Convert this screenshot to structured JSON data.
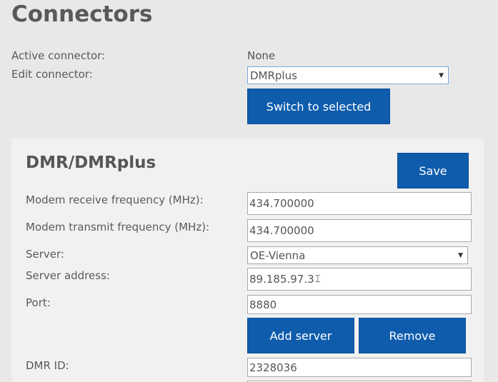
{
  "page": {
    "title": "Connectors"
  },
  "connectors": {
    "active_label": "Active connector:",
    "active_value": "None",
    "edit_label": "Edit connector:",
    "edit_selected": "DMRplus",
    "switch_button": "Switch to selected"
  },
  "panel": {
    "title": "DMR/DMRplus",
    "save_button": "Save",
    "rx_label": "Modem receive frequency (MHz):",
    "rx_value": "434.700000",
    "tx_label": "Modem transmit frequency (MHz):",
    "tx_value": "434.700000",
    "server_label": "Server:",
    "server_selected": "OE-Vienna",
    "address_label": "Server address:",
    "address_value": "89.185.97.3",
    "port_label": "Port:",
    "port_value": "8880",
    "add_server_button": "Add server",
    "remove_button": "Remove",
    "dmr_id_label": "DMR ID:",
    "dmr_id_value": "2328036"
  },
  "icons": {
    "dropdown": "chevron-down-icon",
    "cursor": "text-cursor-icon"
  },
  "colors": {
    "button_bg": "#0f5cad",
    "page_bg": "#e8e8e8",
    "panel_bg": "#f1f1f1"
  }
}
